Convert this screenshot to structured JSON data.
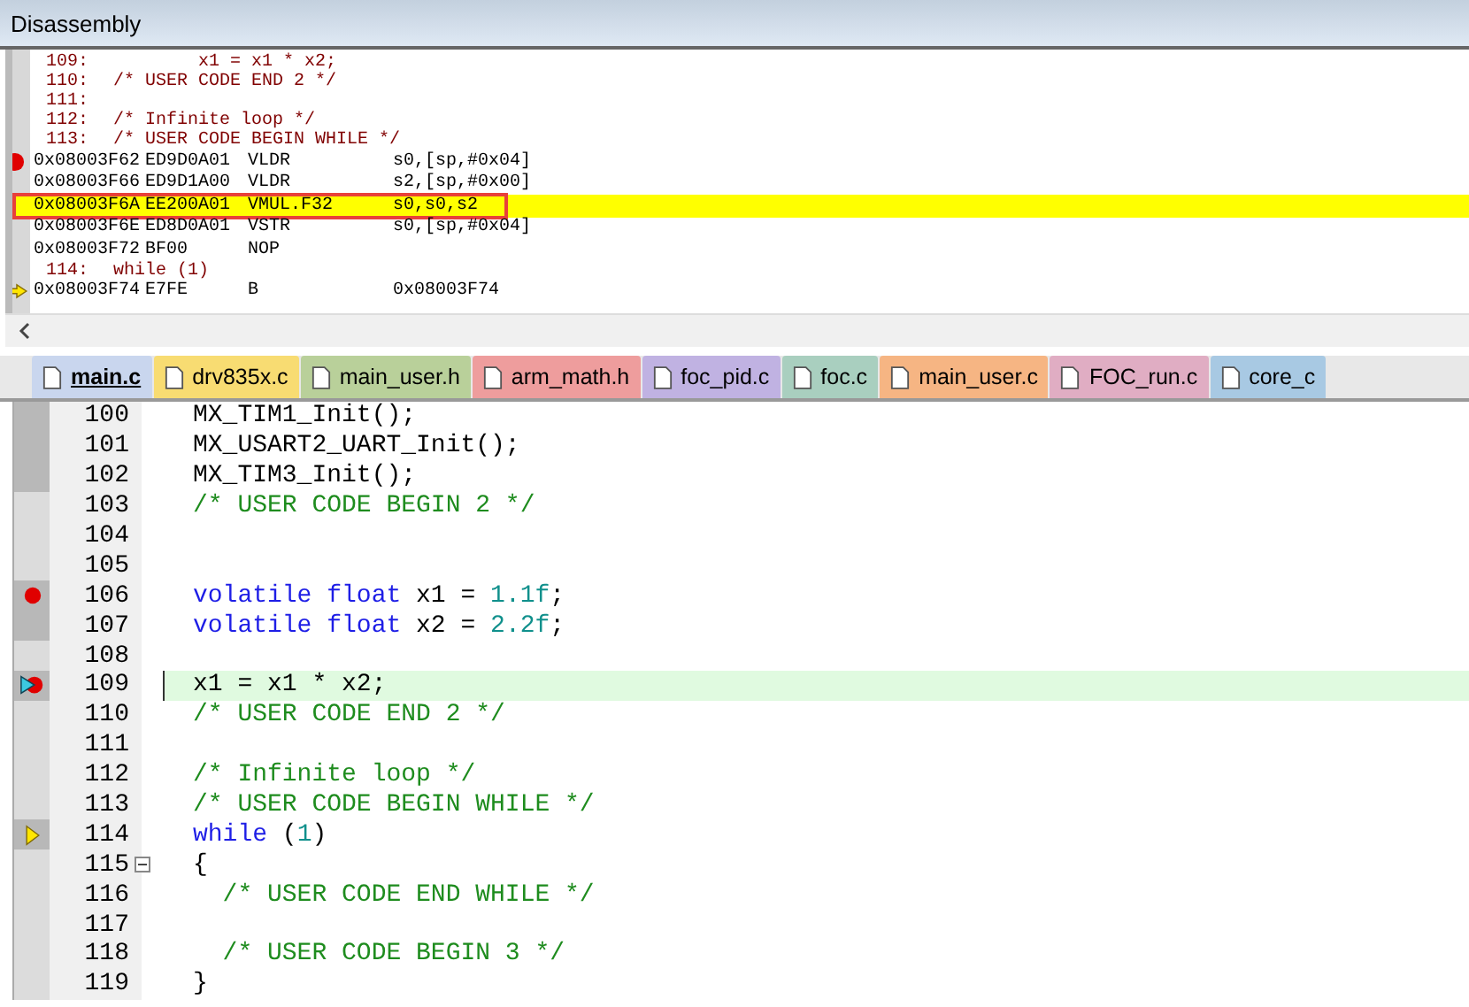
{
  "disassembly": {
    "title": "Disassembly",
    "rows": [
      {
        "kind": "src",
        "line": "109:",
        "code": "        x1 = x1 * x2;"
      },
      {
        "kind": "src",
        "line": "110:",
        "code": "/* USER CODE END 2 */"
      },
      {
        "kind": "src",
        "line": "111:"
      },
      {
        "kind": "src",
        "line": "112:",
        "code": "/* Infinite loop */"
      },
      {
        "kind": "src",
        "line": "113:",
        "code": "/* USER CODE BEGIN WHILE */"
      },
      {
        "kind": "asm",
        "address": "0x08003F62",
        "opcode": "ED9D0A01",
        "mnemonic": "VLDR",
        "operands": "s0,[sp,#0x04]",
        "breakpoint": true,
        "arrow": false,
        "current": false,
        "boxed": false
      },
      {
        "kind": "asm",
        "address": "0x08003F66",
        "opcode": "ED9D1A00",
        "mnemonic": "VLDR",
        "operands": "s2,[sp,#0x00]",
        "breakpoint": false,
        "arrow": false,
        "current": false,
        "boxed": false
      },
      {
        "kind": "asm",
        "address": "0x08003F6A",
        "opcode": "EE200A01",
        "mnemonic": "VMUL.F32",
        "operands": "s0,s0,s2",
        "breakpoint": false,
        "arrow": false,
        "current": true,
        "boxed": true
      },
      {
        "kind": "asm",
        "address": "0x08003F6E",
        "opcode": "ED8D0A01",
        "mnemonic": "VSTR",
        "operands": "s0,[sp,#0x04]",
        "breakpoint": false,
        "arrow": false,
        "current": false,
        "boxed": false
      },
      {
        "kind": "asm",
        "address": "0x08003F72",
        "opcode": "BF00",
        "mnemonic": "NOP",
        "breakpoint": false,
        "arrow": false,
        "current": false,
        "boxed": false
      },
      {
        "kind": "src",
        "line": "114:",
        "code": "while (1)"
      },
      {
        "kind": "asm",
        "address": "0x08003F74",
        "opcode": "E7FE",
        "mnemonic": "B",
        "operands": "0x08003F74",
        "breakpoint": false,
        "arrow": true,
        "current": false,
        "boxed": false
      }
    ]
  },
  "tabs": [
    {
      "label": "main.c",
      "selected": true,
      "color": "#c9d6ee"
    },
    {
      "label": "drv835x.c",
      "selected": false,
      "color": "#f8dc72"
    },
    {
      "label": "main_user.h",
      "selected": false,
      "color": "#b9d09a"
    },
    {
      "label": "arm_math.h",
      "selected": false,
      "color": "#ee9d9d"
    },
    {
      "label": "foc_pid.c",
      "selected": false,
      "color": "#c0b2e2"
    },
    {
      "label": "foc.c",
      "selected": false,
      "color": "#a9cfbf"
    },
    {
      "label": "main_user.c",
      "selected": false,
      "color": "#f6b583"
    },
    {
      "label": "FOC_run.c",
      "selected": false,
      "color": "#e0adc3"
    },
    {
      "label": "core_c",
      "selected": false,
      "color": "#a8c9e3"
    }
  ],
  "editor": {
    "lines": [
      {
        "num": "100",
        "covered": true,
        "breakpoint": false,
        "current": false,
        "caller": false,
        "fold": false,
        "tokens": [
          {
            "kind": "plain",
            "text": "MX_TIM1_Init();"
          }
        ]
      },
      {
        "num": "101",
        "covered": true,
        "breakpoint": false,
        "current": false,
        "caller": false,
        "fold": false,
        "tokens": [
          {
            "kind": "plain",
            "text": "MX_USART2_UART_Init();"
          }
        ]
      },
      {
        "num": "102",
        "covered": true,
        "breakpoint": false,
        "current": false,
        "caller": false,
        "fold": false,
        "tokens": [
          {
            "kind": "plain",
            "text": "MX_TIM3_Init();"
          }
        ]
      },
      {
        "num": "103",
        "covered": false,
        "breakpoint": false,
        "current": false,
        "caller": false,
        "fold": false,
        "tokens": [
          {
            "kind": "comment",
            "text": "/* USER CODE BEGIN 2 */"
          }
        ]
      },
      {
        "num": "104",
        "covered": false,
        "breakpoint": false,
        "current": false,
        "caller": false,
        "fold": false
      },
      {
        "num": "105",
        "covered": false,
        "breakpoint": false,
        "current": false,
        "caller": false,
        "fold": false
      },
      {
        "num": "106",
        "covered": true,
        "breakpoint": true,
        "current": false,
        "caller": false,
        "fold": false,
        "tokens": [
          {
            "kind": "keyword",
            "text": "volatile float"
          },
          {
            "kind": "plain",
            "text": " x1 = "
          },
          {
            "kind": "number",
            "text": "1.1f"
          },
          {
            "kind": "plain",
            "text": ";"
          }
        ]
      },
      {
        "num": "107",
        "covered": true,
        "breakpoint": false,
        "current": false,
        "caller": false,
        "fold": false,
        "tokens": [
          {
            "kind": "keyword",
            "text": "volatile float"
          },
          {
            "kind": "plain",
            "text": " x2 = "
          },
          {
            "kind": "number",
            "text": "2.2f"
          },
          {
            "kind": "plain",
            "text": ";"
          }
        ]
      },
      {
        "num": "108",
        "covered": false,
        "breakpoint": false,
        "current": false,
        "caller": false,
        "fold": false
      },
      {
        "num": "109",
        "covered": true,
        "breakpoint": true,
        "current": true,
        "caller": false,
        "fold": false,
        "tokens": [
          {
            "kind": "plain",
            "text": "x1 = x1 * x2;"
          }
        ]
      },
      {
        "num": "110",
        "covered": false,
        "breakpoint": false,
        "current": false,
        "caller": false,
        "fold": false,
        "tokens": [
          {
            "kind": "comment",
            "text": "/* USER CODE END 2 */"
          }
        ]
      },
      {
        "num": "111",
        "covered": false,
        "breakpoint": false,
        "current": false,
        "caller": false,
        "fold": false
      },
      {
        "num": "112",
        "covered": false,
        "breakpoint": false,
        "current": false,
        "caller": false,
        "fold": false,
        "tokens": [
          {
            "kind": "comment",
            "text": "/* Infinite loop */"
          }
        ]
      },
      {
        "num": "113",
        "covered": false,
        "breakpoint": false,
        "current": false,
        "caller": false,
        "fold": false,
        "tokens": [
          {
            "kind": "comment",
            "text": "/* USER CODE BEGIN WHILE */"
          }
        ]
      },
      {
        "num": "114",
        "covered": true,
        "breakpoint": false,
        "current": false,
        "caller": true,
        "fold": false,
        "tokens": [
          {
            "kind": "keyword",
            "text": "while"
          },
          {
            "kind": "plain",
            "text": " ("
          },
          {
            "kind": "number",
            "text": "1"
          },
          {
            "kind": "plain",
            "text": ")"
          }
        ]
      },
      {
        "num": "115",
        "covered": false,
        "breakpoint": false,
        "current": false,
        "caller": false,
        "fold": true,
        "tokens": [
          {
            "kind": "plain",
            "text": "{"
          }
        ]
      },
      {
        "num": "116",
        "covered": false,
        "breakpoint": false,
        "current": false,
        "caller": false,
        "fold": false,
        "tokens": [
          {
            "kind": "comment",
            "text": "  /* USER CODE END WHILE */"
          }
        ]
      },
      {
        "num": "117",
        "covered": false,
        "breakpoint": false,
        "current": false,
        "caller": false,
        "fold": false
      },
      {
        "num": "118",
        "covered": false,
        "breakpoint": false,
        "current": false,
        "caller": false,
        "fold": false,
        "tokens": [
          {
            "kind": "comment",
            "text": "  /* USER CODE BEGIN 3 */"
          }
        ]
      },
      {
        "num": "119",
        "covered": false,
        "breakpoint": false,
        "current": false,
        "caller": false,
        "fold": false,
        "tokens": [
          {
            "kind": "plain",
            "text": "}"
          }
        ]
      }
    ]
  }
}
